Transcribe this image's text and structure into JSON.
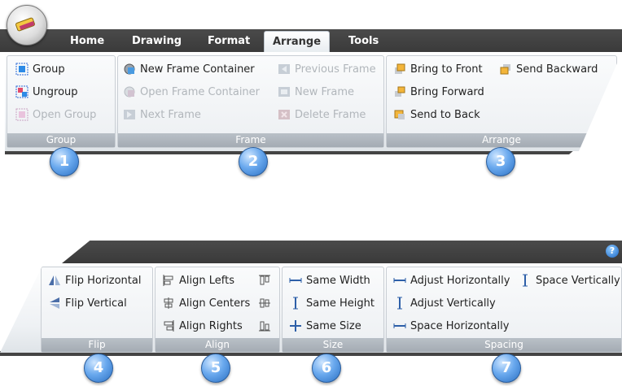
{
  "ribbon_top": {
    "tabs": [
      "Home",
      "Drawing",
      "Format",
      "Arrange",
      "Tools"
    ],
    "active_tab": "Arrange",
    "groups": {
      "group": {
        "label": "Group",
        "items": [
          "Group",
          "Ungroup",
          "Open Group"
        ]
      },
      "frame": {
        "label": "Frame",
        "items": [
          "New Frame Container",
          "Previous Frame",
          "Open Frame Container",
          "New Frame",
          "Next Frame",
          "Delete Frame"
        ]
      },
      "arrange": {
        "label": "Arrange",
        "items": [
          "Bring to Front",
          "Send Backward",
          "Bring Forward",
          "Send to Back"
        ]
      }
    }
  },
  "ribbon_bottom": {
    "help_label": "?",
    "groups": {
      "flip": {
        "label": "Flip",
        "items": [
          "Flip Horizontal",
          "Flip Vertical"
        ]
      },
      "align": {
        "label": "Align",
        "items": [
          "Align Lefts",
          "Align Centers",
          "Align Rights"
        ]
      },
      "size": {
        "label": "Size",
        "items": [
          "Same Width",
          "Same Height",
          "Same Size"
        ]
      },
      "spacing": {
        "label": "Spacing",
        "items": [
          "Adjust Horizontally",
          "Space Vertically",
          "Adjust Vertically",
          "Space Horizontally"
        ]
      }
    }
  },
  "callouts": [
    "1",
    "2",
    "3",
    "4",
    "5",
    "6",
    "7"
  ]
}
